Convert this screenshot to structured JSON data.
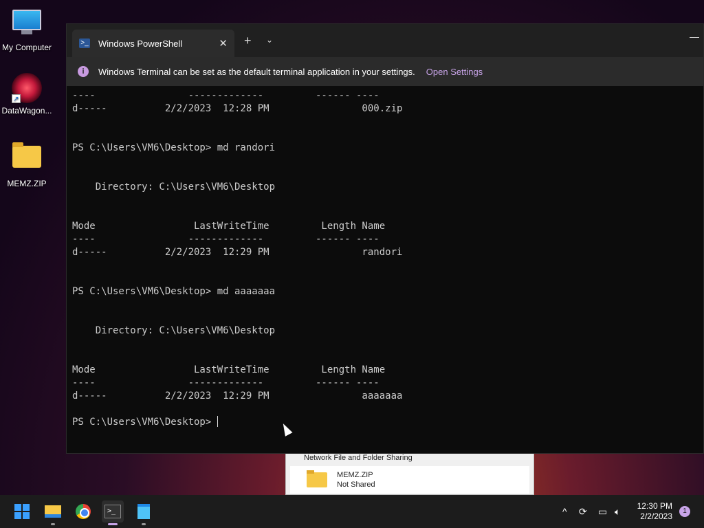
{
  "desktop": {
    "icons": [
      {
        "label": "My Computer",
        "icon": "computer-icon"
      },
      {
        "label": "DataWagon...",
        "icon": "datawagon-icon"
      },
      {
        "label": "MEMZ.ZIP",
        "icon": "folder-icon"
      }
    ]
  },
  "background_window": {
    "caption": "Network File and Folder Sharing",
    "item_name": "MEMZ.ZIP",
    "item_status": "Not Shared"
  },
  "terminal": {
    "tab_title": "Windows PowerShell",
    "tab_close": "✕",
    "new_tab": "+",
    "dropdown": "⌄",
    "minimize": "—",
    "infobar": {
      "text": "Windows Terminal can be set as the default terminal application in your settings.",
      "link": "Open Settings"
    },
    "lines": [
      "----                -------------         ------ ----",
      "d-----          2/2/2023  12:28 PM                000.zip",
      "",
      "",
      "PS C:\\Users\\VM6\\Desktop> md randori",
      "",
      "",
      "    Directory: C:\\Users\\VM6\\Desktop",
      "",
      "",
      "Mode                 LastWriteTime         Length Name",
      "----                -------------         ------ ----",
      "d-----          2/2/2023  12:29 PM                randori",
      "",
      "",
      "PS C:\\Users\\VM6\\Desktop> md aaaaaaa",
      "",
      "",
      "    Directory: C:\\Users\\VM6\\Desktop",
      "",
      "",
      "Mode                 LastWriteTime         Length Name",
      "----                -------------         ------ ----",
      "d-----          2/2/2023  12:29 PM                aaaaaaa",
      "",
      ""
    ],
    "prompt": "PS C:\\Users\\VM6\\Desktop> "
  },
  "taskbar": {
    "apps": [
      {
        "name": "start",
        "icon": "windows-logo-icon"
      },
      {
        "name": "file-explorer",
        "icon": "file-explorer-icon"
      },
      {
        "name": "chrome",
        "icon": "chrome-icon"
      },
      {
        "name": "terminal",
        "icon": "terminal-icon"
      },
      {
        "name": "notepad",
        "icon": "notepad-icon"
      }
    ],
    "tray": {
      "chevron": "^",
      "time": "12:30 PM",
      "date": "2/2/2023",
      "notification_count": "1"
    }
  },
  "colors": {
    "accent": "#c8a4e8",
    "terminal_bg": "#0c0c0c",
    "taskbar_bg": "#1c1c1c"
  }
}
